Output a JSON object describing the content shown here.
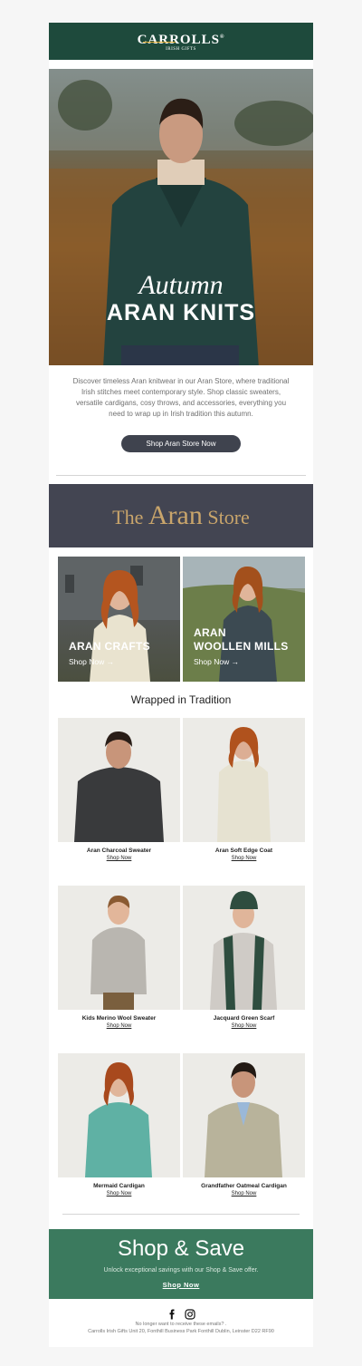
{
  "header": {
    "logo_main": "CARROLLS",
    "logo_registered": "®",
    "logo_sub": "IRISH GIFTS"
  },
  "hero": {
    "script_text": "Autumn",
    "title": "ARAN KNITS"
  },
  "intro": {
    "text": "Discover timeless Aran knitwear in our Aran Store, where traditional Irish stitches meet contemporary style. Shop classic sweaters, versatile cardigans, cosy throws, and accessories, everything you need to wrap up in Irish tradition this autumn.",
    "button_label": "Shop Aran Store Now"
  },
  "store_banner": {
    "word_the": "The",
    "word_aran": "Aran",
    "word_store": "Store"
  },
  "category_tiles": [
    {
      "title_line1": "ARAN CRAFTS",
      "title_line2": "",
      "link": "Shop Now →"
    },
    {
      "title_line1": "ARAN",
      "title_line2": "WOOLLEN MILLS",
      "link": "Shop Now →"
    }
  ],
  "section": {
    "heading": "Wrapped in Tradition"
  },
  "products": [
    {
      "name": "Aran Charcoal Sweater",
      "link": "Shop Now"
    },
    {
      "name": "Aran Soft Edge Coat",
      "link": "Shop Now"
    },
    {
      "name": "Kids Merino Wool Sweater",
      "link": "Shop Now"
    },
    {
      "name": "Jacquard Green Scarf",
      "link": "Shop Now"
    },
    {
      "name": "Mermaid Cardigan",
      "link": "Shop Now"
    },
    {
      "name": "Grandfather Oatmeal Cardigan",
      "link": "Shop Now"
    }
  ],
  "promo": {
    "title": "Shop & Save",
    "text": "Unlock exceptional savings with our Shop & Save offer.",
    "link": "Shop Now"
  },
  "footer": {
    "unsubscribe": "No longer want to receive these emails? .",
    "address": "Carrolls Irish Gifts Unit 20, Fonthill Business Park Fonthill Dublin, Leinster D22 RF90",
    "social_icons": [
      "facebook-icon",
      "instagram-icon"
    ]
  },
  "colors": {
    "header_green": "#1e4a3c",
    "promo_green": "#3b7a5e",
    "store_banner": "#434552",
    "button_dark": "#3f434e",
    "store_gold": "#c9a56b"
  }
}
